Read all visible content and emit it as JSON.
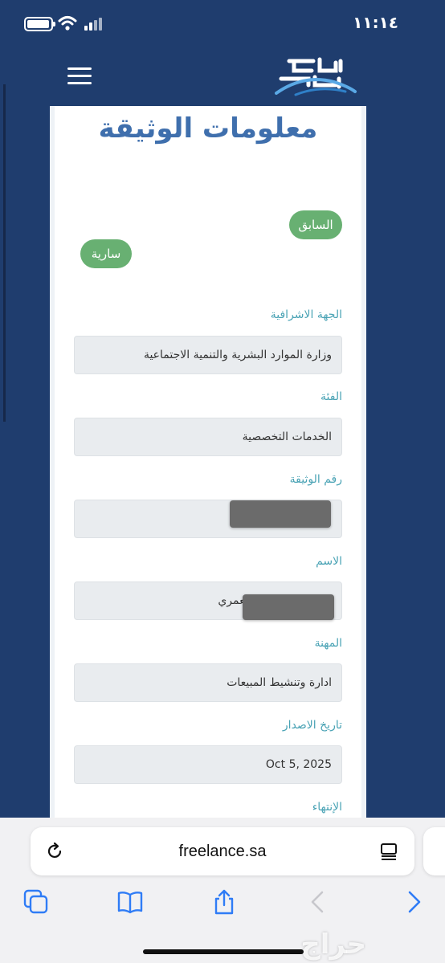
{
  "status_bar": {
    "time": "١١:١٤"
  },
  "page": {
    "title": "معلومات الوثيقة"
  },
  "buttons": {
    "previous": "السابق",
    "status_badge": "سارية"
  },
  "fields": [
    {
      "label": "الجهة الاشرافية",
      "value": "وزارة الموارد البشرية والتنمية الاجتماعية"
    },
    {
      "label": "الفئة",
      "value": "الخدمات التخصصية"
    },
    {
      "label": "رقم الوثيقة",
      "value": ""
    },
    {
      "label": "الاسم",
      "value": "العمري"
    },
    {
      "label": "المهنة",
      "value": "ادارة وتنشيط المبيعات"
    },
    {
      "label": "تاريخ الاصدار",
      "value": "Oct 5, 2025"
    },
    {
      "label": "الإنتهاء",
      "value": ""
    }
  ],
  "browser": {
    "url": "freelance.sa"
  },
  "watermark": "حراج",
  "colors": {
    "header_bg": "#1f3d6e",
    "title": "#3f6fad",
    "badge": "#68b072",
    "label": "#4aa3b5",
    "safari_accent": "#2f7cf6"
  }
}
